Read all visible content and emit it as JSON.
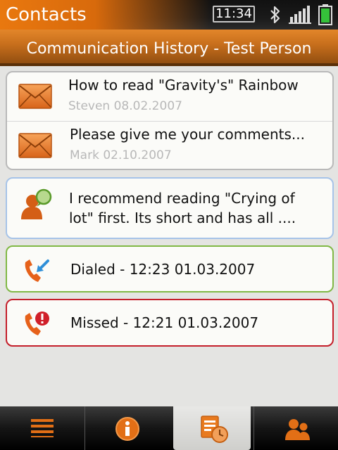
{
  "app": {
    "title": "Contacts"
  },
  "status": {
    "time": "11:34",
    "icons": [
      "bluetooth-icon",
      "signal-icon",
      "battery-icon"
    ]
  },
  "header": {
    "title": "Communication History - Test Person"
  },
  "messages": [
    {
      "title": "How to read \"Gravity's\" Rainbow",
      "meta": "Steven 08.02.2007",
      "icon": "email-icon"
    },
    {
      "title": "Please give me your comments...",
      "meta": "Mark 02.10.2007",
      "icon": "email-icon"
    }
  ],
  "chat": {
    "line1": "I recommend reading \"Crying of",
    "line2": "lot\" first. Its short and has all ....",
    "icon": "chat-contact-icon"
  },
  "calls": [
    {
      "label": "Dialed - 12:23 01.03.2007",
      "icon": "dialed-call-icon",
      "status_color": "#80b845"
    },
    {
      "label": "Missed - 12:21 01.03.2007",
      "icon": "missed-call-icon",
      "status_color": "#c41e2a"
    }
  ],
  "tabs": [
    {
      "name": "menu",
      "icon": "menu-icon",
      "selected": false
    },
    {
      "name": "info",
      "icon": "info-icon",
      "selected": false
    },
    {
      "name": "history",
      "icon": "history-icon",
      "selected": true
    },
    {
      "name": "contacts",
      "icon": "contacts-icon",
      "selected": false
    }
  ],
  "colors": {
    "accent": "#e9780f",
    "header_bg": "#c86f1c"
  }
}
